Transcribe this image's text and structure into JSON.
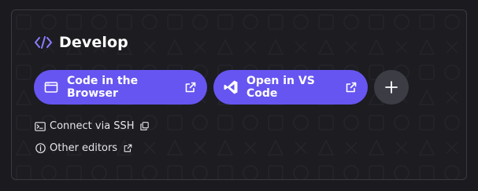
{
  "section": {
    "title": "Develop",
    "icon": "code-brackets-icon"
  },
  "buttons": {
    "browser": {
      "label": "Code in the Browser",
      "icon": "browser-window-icon",
      "trailing_icon": "external-link-icon"
    },
    "vscode": {
      "label": "Open in VS Code",
      "icon": "vscode-icon",
      "trailing_icon": "external-link-icon"
    },
    "more": {
      "icon": "plus-icon"
    }
  },
  "links": {
    "ssh": {
      "label": "Connect via SSH",
      "icon": "terminal-icon",
      "trailing_icon": "copy-icon"
    },
    "editors": {
      "label": "Other editors",
      "icon": "info-icon",
      "trailing_icon": "external-link-icon"
    }
  },
  "colors": {
    "accent": "#6655f0",
    "card_bg": "#1c1c21",
    "card_border": "#3a3a42",
    "secondary_button": "#3c3c45",
    "icon_accent": "#8b7cff"
  }
}
